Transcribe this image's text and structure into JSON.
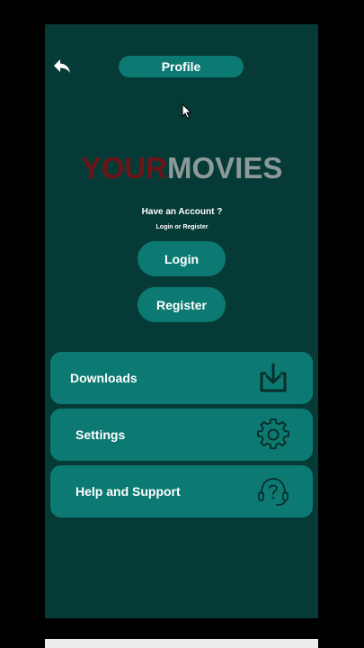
{
  "header": {
    "title": "Profile",
    "back_icon": "back-arrow-icon"
  },
  "brand": {
    "part1": "YOUR",
    "part2": "MOVIES",
    "color_part1": "#6e1418",
    "color_part2": "#8c9a98"
  },
  "auth": {
    "prompt": "Have an Account ?",
    "subprompt": "Login or Register",
    "login_label": "Login",
    "register_label": "Register"
  },
  "menu": {
    "items": [
      {
        "label": "Downloads",
        "icon": "download-icon"
      },
      {
        "label": "Settings",
        "icon": "gear-icon"
      },
      {
        "label": "Help and Support",
        "icon": "headset-help-icon"
      }
    ]
  },
  "colors": {
    "background": "#063a36",
    "accent": "#0c7a72",
    "icon": "#0a2e2b"
  }
}
